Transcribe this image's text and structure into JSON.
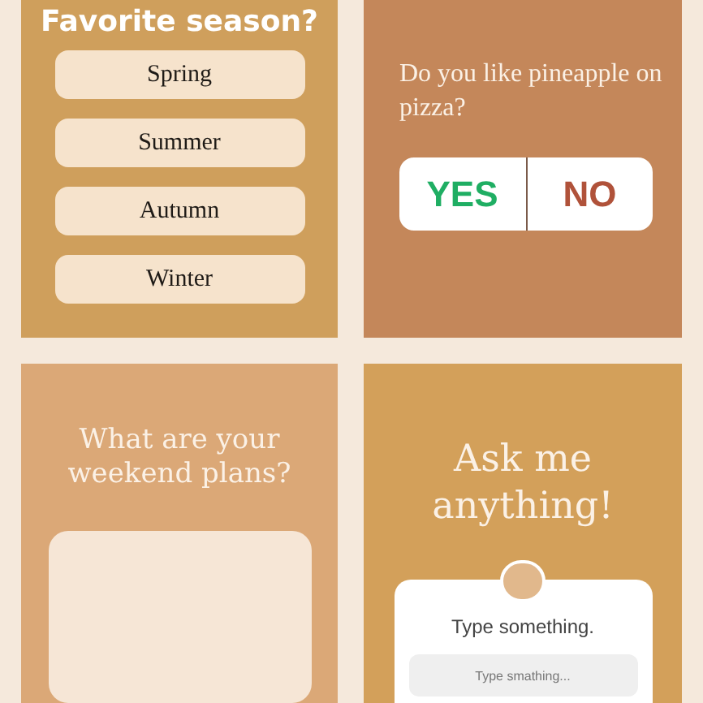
{
  "cards": [
    {
      "kind": "choices",
      "title": "Favorite season?",
      "options": [
        "Spring",
        "Summer",
        "Autumn",
        "Winter"
      ]
    },
    {
      "kind": "poll",
      "question": "Do you like pineapple on pizza?",
      "answers": [
        {
          "label": "YES",
          "kind": "yes"
        },
        {
          "label": "NO",
          "kind": "no"
        }
      ]
    },
    {
      "kind": "text",
      "title": "What are your weekend plans?"
    },
    {
      "kind": "ask",
      "title": "Ask me anything!",
      "prompt": "Type something.",
      "placeholder": "Type smathing..."
    }
  ]
}
